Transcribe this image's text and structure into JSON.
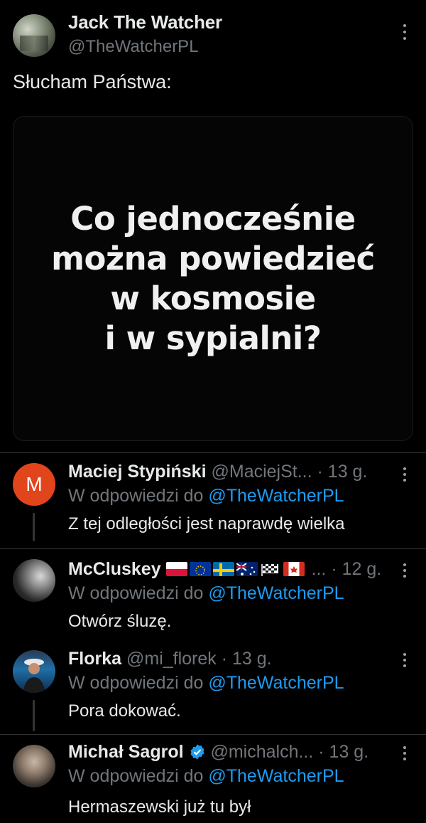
{
  "tweet": {
    "author_name": "Jack The Watcher",
    "author_handle": "@TheWatcherPL",
    "text": "Słucham Państwa:",
    "media_lines": [
      "Co jednocześnie",
      "można powiedzieć",
      "w kosmosie",
      "i w sypialni?"
    ],
    "more_icon": "more-vertical-icon"
  },
  "replies": [
    {
      "name": "Maciej Stypiński",
      "handle": "@MaciejSt...",
      "time": "· 13 g.",
      "reply_prefix": "W odpowiedzi do",
      "reply_to": "@TheWatcherPL",
      "text": "Z tej odległości jest naprawdę wielka",
      "avatar_letter": "M",
      "avatar_color": "#e2441b"
    },
    {
      "name": "McCluskey",
      "ellipsis": "...",
      "time": "· 12 g.",
      "reply_prefix": "W odpowiedzi do",
      "reply_to": "@TheWatcherPL",
      "text": "Otwórz śluzę.",
      "flags": [
        "poland-flag",
        "eu-flag",
        "sweden-flag",
        "australia-flag",
        "checkered-flag",
        "canada-flag"
      ]
    },
    {
      "name": "Florka",
      "handle": "@mi_florek",
      "time": "· 13 g.",
      "reply_prefix": "W odpowiedzi do",
      "reply_to": "@TheWatcherPL",
      "text": "Pora dokować."
    },
    {
      "name": "Michał Sagrol",
      "handle": "@michalch...",
      "time": "· 13 g.",
      "reply_prefix": "W odpowiedzi do",
      "reply_to": "@TheWatcherPL",
      "text": "Hermaszewski już tu był",
      "verified_icon": "verified-badge-icon"
    }
  ],
  "colors": {
    "background": "#000000",
    "text": "#e7e9ea",
    "secondary": "#71767b",
    "link": "#1d9bf0"
  }
}
